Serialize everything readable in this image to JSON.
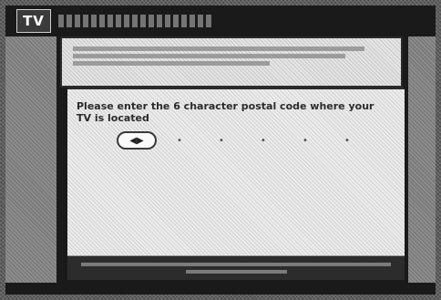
{
  "header": {
    "badge": "TV",
    "title": ""
  },
  "info": {
    "text": ""
  },
  "prompt": {
    "text": "Please enter the 6 character postal code where your TV is located"
  },
  "code_entry": {
    "slots": [
      "",
      "",
      "",
      "",
      "",
      ""
    ],
    "active_index": 0
  },
  "footer": {
    "instruction": ""
  },
  "colors": {
    "frame": "#1a1a1a",
    "panel": "#ededed",
    "badge_bg": "#3b3b3b"
  }
}
